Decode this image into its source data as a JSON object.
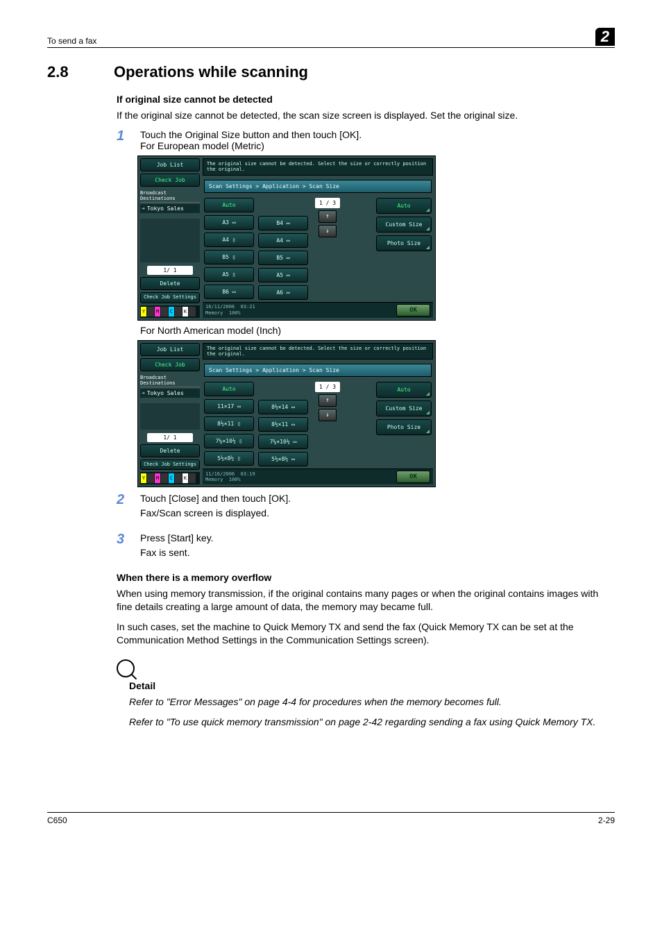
{
  "header": {
    "left": "To send a fax",
    "chapter": "2"
  },
  "section": {
    "number": "2.8",
    "title": "Operations while scanning"
  },
  "sub1": {
    "heading": "If original size cannot be detected",
    "para": "If the original size cannot be detected, the scan size screen is displayed. Set the original size."
  },
  "steps": {
    "s1": {
      "num": "1",
      "text": "Touch the Original Size button and then touch [OK].",
      "caption_a": "For European model (Metric)",
      "caption_b": "For North American model (Inch)"
    },
    "s2": {
      "num": "2",
      "text": "Touch [Close] and then touch [OK].",
      "sub": "Fax/Scan screen is displayed."
    },
    "s3": {
      "num": "3",
      "text": "Press [Start] key.",
      "sub": "Fax is sent."
    }
  },
  "sub2": {
    "heading": "When there is a memory overflow",
    "p1": "When using memory transmission, if the original contains many pages or when the original contains images with fine details creating a large amount of data, the memory may became full.",
    "p2": "In such cases, set the machine to Quick Memory TX and send the fax (Quick Memory TX can be set at the Communication Method Settings in the Communication Settings screen)."
  },
  "detail": {
    "label": "Detail",
    "p1": "Refer to \"Error Messages\" on page 4-4 for procedures when the memory becomes full.",
    "p2": "Refer to \"To use quick memory transmission\" on page 2-42 regarding sending a fax using Quick Memory TX."
  },
  "footer": {
    "left": "C650",
    "right": "2-29"
  },
  "screenA": {
    "joblist": "Job List",
    "checkjob": "Check Job",
    "dest_label": "Broadcast Destinations",
    "dest_item": "Tokyo Sales",
    "counter": "1/  1",
    "delete": "Delete",
    "checkset": "Check Job Settings",
    "msg": "The original size cannot be detected. Select the size or correctly position the original.",
    "breadcrumb": "Scan Settings > Application > Scan Size",
    "page": "1 / 3",
    "tabs": {
      "auto": "Auto",
      "custom": "Custom Size",
      "photo": "Photo Size"
    },
    "sizes_col1": [
      "Auto",
      "A3 ▭",
      "A4 ▯",
      "B5 ▯",
      "A5 ▯",
      "B6 ▭"
    ],
    "sizes_col2": [
      "",
      "B4 ▭",
      "A4 ▭",
      "B5 ▭",
      "A5 ▭",
      "A6 ▭"
    ],
    "time": {
      "date": "16/11/2006",
      "clock": "03:21",
      "mem": "Memory",
      "pct": "100%"
    },
    "ok": "OK"
  },
  "screenB": {
    "joblist": "Job List",
    "checkjob": "Check Job",
    "dest_label": "Broadcast Destinations",
    "dest_item": "Tokyo Sales",
    "counter": "1/  1",
    "delete": "Delete",
    "checkset": "Check Job Settings",
    "msg": "The original size cannot be detected. Select the size or correctly position the original.",
    "breadcrumb": "Scan Settings > Application > Scan Size",
    "page": "1 / 3",
    "tabs": {
      "auto": "Auto",
      "custom": "Custom Size",
      "photo": "Photo Size"
    },
    "sizes_col1": [
      "Auto",
      "11×17 ▭",
      "8½×11 ▯",
      "7¼×10½ ▯",
      "5½×8½ ▯"
    ],
    "sizes_col2": [
      "",
      "8½×14 ▭",
      "8½×11 ▭",
      "7¼×10½ ▭",
      "5½×8½ ▭"
    ],
    "time": {
      "date": "11/16/2006",
      "clock": "03:19",
      "mem": "Memory",
      "pct": "100%"
    },
    "ok": "OK"
  },
  "chart_data": {
    "type": "table",
    "title": "Scan Size selection screens",
    "series": [
      {
        "name": "European (Metric) sizes",
        "values": [
          "Auto",
          "A3",
          "A4 (portrait)",
          "A4 (landscape)",
          "B4",
          "B5 (portrait)",
          "B5 (landscape)",
          "A5 (portrait)",
          "A5 (landscape)",
          "B6",
          "A6"
        ]
      },
      {
        "name": "North American (Inch) sizes",
        "values": [
          "Auto",
          "11×17",
          "8½×14",
          "8½×11 (portrait)",
          "8½×11 (landscape)",
          "7¼×10½ (portrait)",
          "7¼×10½ (landscape)",
          "5½×8½ (portrait)",
          "5½×8½ (landscape)"
        ]
      }
    ]
  }
}
